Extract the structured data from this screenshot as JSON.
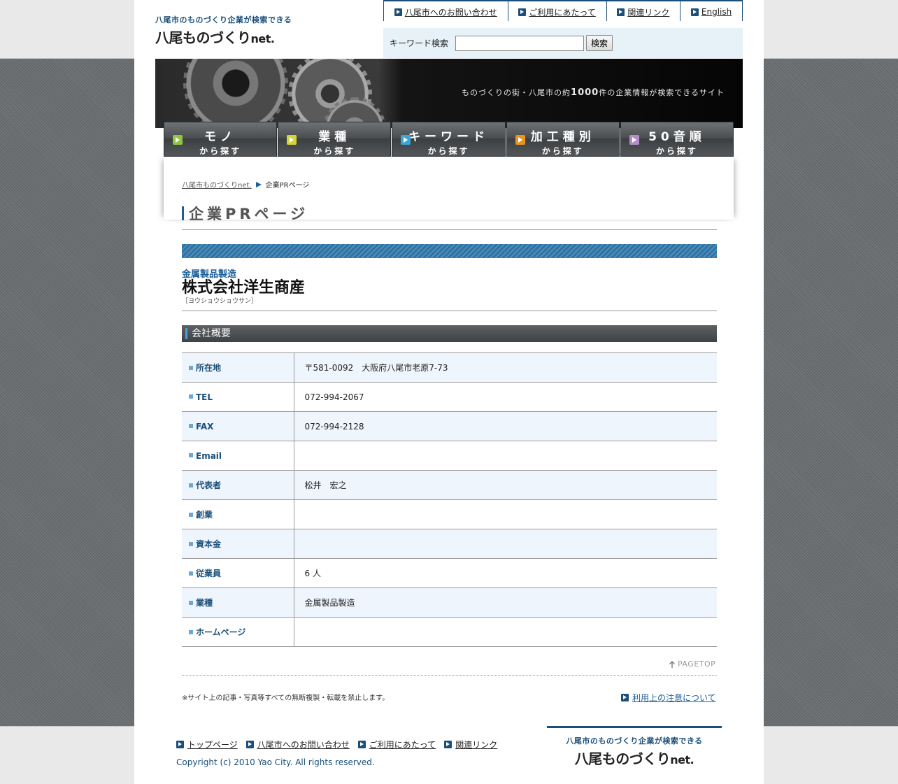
{
  "site": {
    "tagline": "八尾市のものづくり企業が検索できる",
    "name": "八尾ものづくり",
    "name_suffix": "net."
  },
  "topnav": [
    {
      "label": "八尾市へのお問い合わせ"
    },
    {
      "label": "ご利用にあたって"
    },
    {
      "label": "関連リンク"
    },
    {
      "label": "English"
    }
  ],
  "search": {
    "label": "キーワード検索",
    "value": "",
    "button": "検索"
  },
  "banner": {
    "text_before": "ものづくりの街・八尾市の約",
    "text_number": "1000",
    "text_after": "件の企業情報が検索できるサイト"
  },
  "categories": [
    {
      "big": "モノ",
      "small": "から探す",
      "color": "#8cc63f"
    },
    {
      "big": "業種",
      "small": "から探す",
      "color": "#d4d43a"
    },
    {
      "big": "キーワード",
      "small": "から探す",
      "color": "#3aa6d8"
    },
    {
      "big": "加工種別",
      "small": "から探す",
      "color": "#e8941e"
    },
    {
      "big": "50音順",
      "small": "から探す",
      "color": "#b48cc8"
    }
  ],
  "breadcrumb": {
    "home": "八尾市ものづくりnet.",
    "current": "企業PRページ"
  },
  "page_title": "企業PRページ",
  "company": {
    "category": "金属製品製造",
    "name": "株式会社洋生商産",
    "kana": "［ヨウショウショウサン］"
  },
  "section_title": "会社概要",
  "info_rows": [
    {
      "label": "所在地",
      "value": "〒581-0092　大阪府八尾市老原7-73"
    },
    {
      "label": "TEL",
      "value": "072-994-2067"
    },
    {
      "label": "FAX",
      "value": "072-994-2128"
    },
    {
      "label": "Email",
      "value": ""
    },
    {
      "label": "代表者",
      "value": "松井　宏之"
    },
    {
      "label": "創業",
      "value": ""
    },
    {
      "label": "資本金",
      "value": ""
    },
    {
      "label": "従業員",
      "value": "6 人"
    },
    {
      "label": "業種",
      "value": "金属製品製造"
    },
    {
      "label": "ホームページ",
      "value": ""
    }
  ],
  "pagetop": "PAGETOP",
  "note": "※サイト上の記事・写真等すべての無断複製・転載を禁止します。",
  "terms_link": "利用上の注意について",
  "footer": {
    "links": [
      {
        "label": "トップページ"
      },
      {
        "label": "八尾市へのお問い合わせ"
      },
      {
        "label": "ご利用にあたって"
      },
      {
        "label": "関連リンク"
      }
    ],
    "copyright": "Copyright (c) 2010 Yao City. All rights reserved."
  },
  "colors": {
    "brand": "#1b4f7a",
    "accent": "#1b5f9a",
    "row_alt": "#eef5fc"
  }
}
